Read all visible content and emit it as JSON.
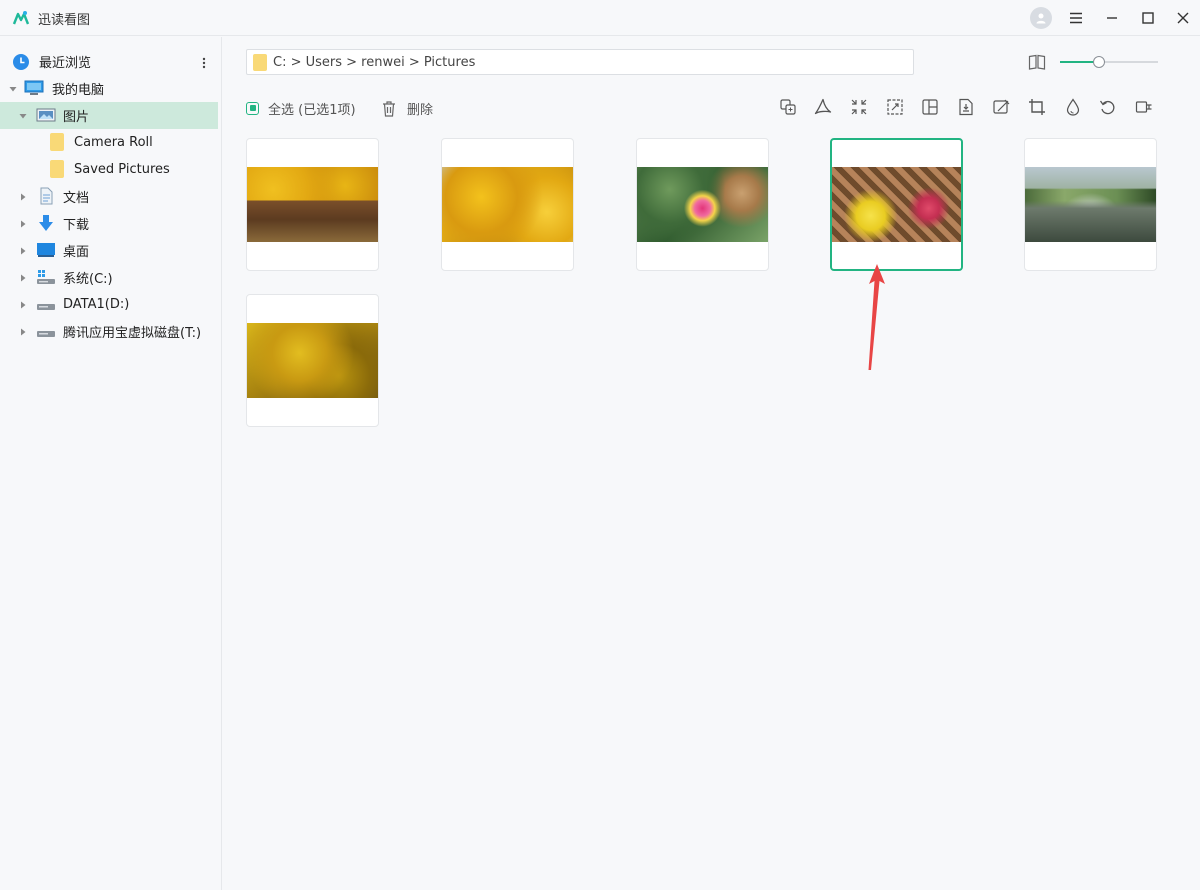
{
  "app": {
    "title": "迅读看图"
  },
  "sidebar": {
    "recent_label": "最近浏览",
    "items": [
      {
        "label": "我的电脑",
        "icon": "computer-icon"
      },
      {
        "label": "图片",
        "icon": "pictures-folder-icon"
      },
      {
        "label": "Camera Roll",
        "icon": "folder-icon"
      },
      {
        "label": "Saved Pictures",
        "icon": "folder-icon"
      },
      {
        "label": "文档",
        "icon": "document-icon"
      },
      {
        "label": "下载",
        "icon": "download-icon"
      },
      {
        "label": "桌面",
        "icon": "desktop-icon"
      },
      {
        "label": "系统(C:)",
        "icon": "system-drive-icon"
      },
      {
        "label": "DATA1(D:)",
        "icon": "drive-icon"
      },
      {
        "label": "腾讯应用宝虚拟磁盘(T:)",
        "icon": "drive-icon"
      }
    ]
  },
  "toolbar": {
    "address_path": "C: > Users > renwei > Pictures",
    "select_all_label": "全选 (已选1项)",
    "delete_label": "删除",
    "zoom_level": 0.4,
    "tools": [
      "format-convert-icon",
      "pdf-icon",
      "compress-icon",
      "resize-icon",
      "collage-icon",
      "image-to-pdf-icon",
      "edit-icon",
      "crop-icon",
      "watermark-icon",
      "rotate-icon",
      "more-icon"
    ]
  },
  "gallery": {
    "selected_index": 3,
    "photos": [
      "ginkgo-temple",
      "ginkgo-branches",
      "pink-flowers",
      "trellis-flowers",
      "bridge-lake",
      "ginkgo-tree"
    ]
  },
  "colors": {
    "accent": "#22b482",
    "selected_bg": "#cde9dc",
    "arrow": "#e84545"
  }
}
